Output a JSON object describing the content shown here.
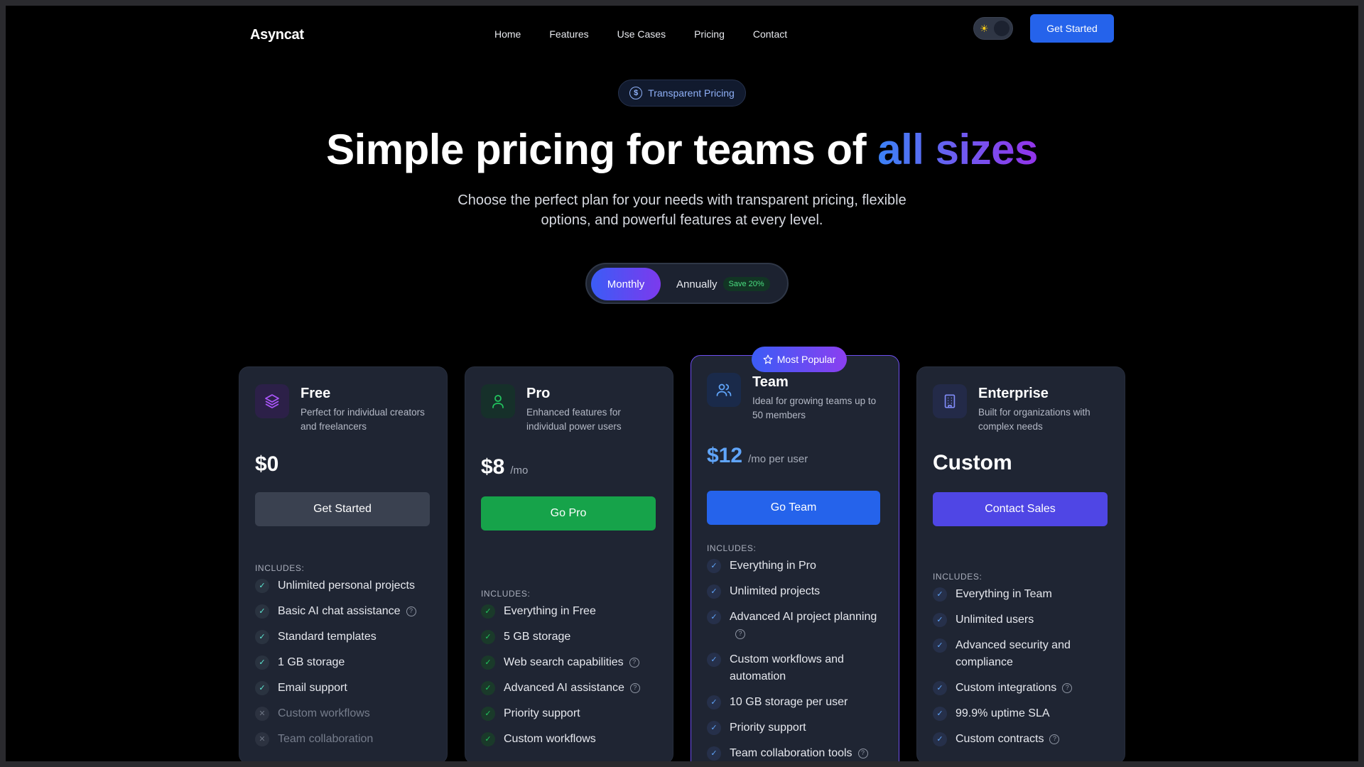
{
  "nav": {
    "logo": "Asyncat",
    "links": [
      "Home",
      "Features",
      "Use Cases",
      "Pricing",
      "Contact"
    ],
    "cta": "Get Started"
  },
  "hero": {
    "badge": "Transparent Pricing",
    "title_main": "Simple pricing for teams of ",
    "title_accent": "all sizes",
    "subtitle": "Choose the perfect plan for your needs with transparent pricing, flexible options, and powerful features at every level."
  },
  "billing": {
    "monthly": "Monthly",
    "annually": "Annually",
    "save": "Save 20%",
    "selected": "Monthly"
  },
  "popular_badge": "Most Popular",
  "includes_label": "INCLUDES:",
  "plans": [
    {
      "name": "Free",
      "desc": "Perfect for individual creators and freelancers",
      "price": "$0",
      "unit": "",
      "cta": "Get Started",
      "icon": "layers-icon",
      "color": "#a855f7",
      "features": [
        {
          "text": "Unlimited personal projects",
          "on": true,
          "help": false
        },
        {
          "text": "Basic AI chat assistance",
          "on": true,
          "help": true
        },
        {
          "text": "Standard templates",
          "on": true,
          "help": false
        },
        {
          "text": "1 GB storage",
          "on": true,
          "help": false
        },
        {
          "text": "Email support",
          "on": true,
          "help": false
        },
        {
          "text": "Custom workflows",
          "on": false,
          "help": false
        },
        {
          "text": "Team collaboration",
          "on": false,
          "help": false
        }
      ]
    },
    {
      "name": "Pro",
      "desc": "Enhanced features for individual power users",
      "price": "$8",
      "unit": "/mo",
      "cta": "Go Pro",
      "icon": "user-icon",
      "color": "#22c55e",
      "features": [
        {
          "text": "Everything in Free",
          "on": true,
          "help": false
        },
        {
          "text": "5 GB storage",
          "on": true,
          "help": false
        },
        {
          "text": "Web search capabilities",
          "on": true,
          "help": true
        },
        {
          "text": "Advanced AI assistance",
          "on": true,
          "help": true
        },
        {
          "text": "Priority support",
          "on": true,
          "help": false
        },
        {
          "text": "Custom workflows",
          "on": true,
          "help": false
        }
      ]
    },
    {
      "name": "Team",
      "desc": "Ideal for growing teams up to 50 members",
      "price": "$12",
      "unit": "/mo per user",
      "cta": "Go Team",
      "icon": "users-icon",
      "color": "#3b82f6",
      "features": [
        {
          "text": "Everything in Pro",
          "on": true,
          "help": false
        },
        {
          "text": "Unlimited projects",
          "on": true,
          "help": false
        },
        {
          "text": "Advanced AI project planning",
          "on": true,
          "help": true
        },
        {
          "text": "Custom workflows and automation",
          "on": true,
          "help": false
        },
        {
          "text": "10 GB storage per user",
          "on": true,
          "help": false
        },
        {
          "text": "Priority support",
          "on": true,
          "help": false
        },
        {
          "text": "Team collaboration tools",
          "on": true,
          "help": true
        }
      ]
    },
    {
      "name": "Enterprise",
      "desc": "Built for organizations with complex needs",
      "price": "Custom",
      "unit": "",
      "cta": "Contact Sales",
      "icon": "building-icon",
      "color": "#6366f1",
      "features": [
        {
          "text": "Everything in Team",
          "on": true,
          "help": false
        },
        {
          "text": "Unlimited users",
          "on": true,
          "help": false
        },
        {
          "text": "Advanced security and compliance",
          "on": true,
          "help": false
        },
        {
          "text": "Custom integrations",
          "on": true,
          "help": true
        },
        {
          "text": "99.9% uptime SLA",
          "on": true,
          "help": false
        },
        {
          "text": "Custom contracts",
          "on": true,
          "help": true
        }
      ]
    }
  ],
  "colors": {
    "free_cta": "#3a4150",
    "pro_cta": "#16a34a",
    "team_cta": "#2563eb",
    "enterprise_cta": "#4f46e5"
  }
}
